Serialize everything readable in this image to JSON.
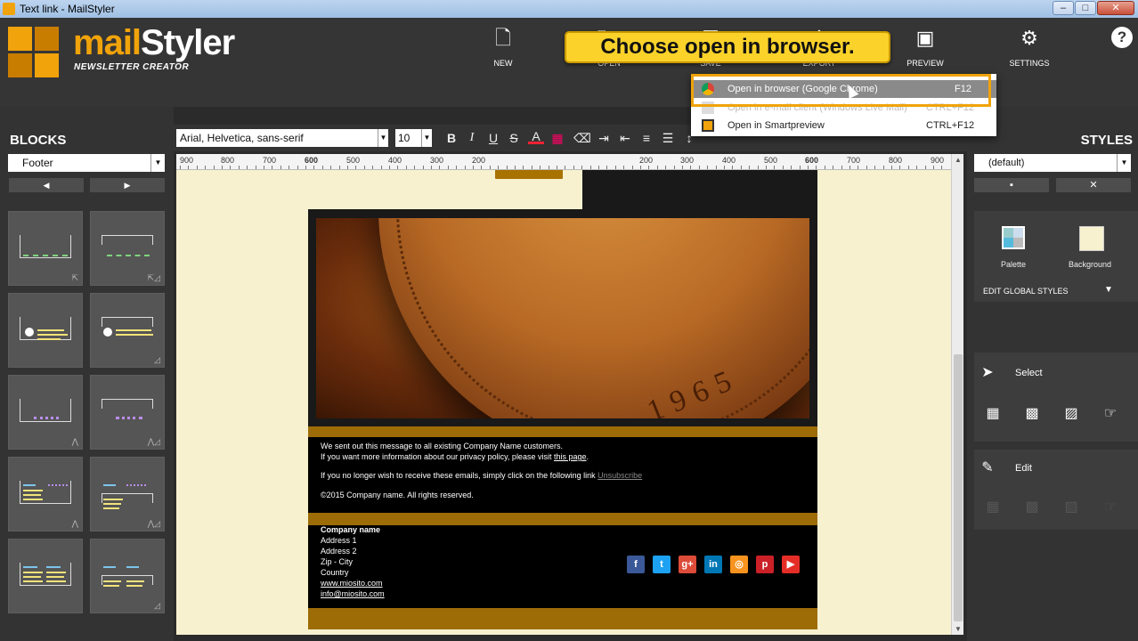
{
  "window": {
    "title": "Text link - MailStyler",
    "minimize": "–",
    "maximize": "□",
    "close": "✕"
  },
  "logo": {
    "brand_a": "mail",
    "brand_b": "Styler",
    "subtitle": "NEWSLETTER CREATOR"
  },
  "toolbar": {
    "new": "NEW",
    "open": "OPEN",
    "save": "SAVE",
    "export": "EXPORT",
    "preview": "PREVIEW",
    "settings": "SETTINGS",
    "help": "?"
  },
  "callout": "Choose open in browser.",
  "export_menu": {
    "items": [
      {
        "label": "Open in browser (Google Chrome)",
        "shortcut": "F12",
        "icon": "chrome-icon"
      },
      {
        "label": "Open in e-mail client (Windows Live Mail)",
        "shortcut": "CTRL+F12",
        "icon": "mail-icon"
      },
      {
        "label": "Open in Smartpreview",
        "shortcut": "CTRL+F12",
        "icon": "smartpreview-icon"
      }
    ]
  },
  "blocks": {
    "title": "BLOCKS",
    "category": "Footer",
    "prev": "◀",
    "next": "▶"
  },
  "format": {
    "font": "Arial, Helvetica, sans-serif",
    "size": "10"
  },
  "ruler": {
    "labels_left": [
      "900",
      "800",
      "700",
      "600",
      "500",
      "400",
      "300",
      "200"
    ],
    "labels_right": [
      "200",
      "300",
      "400",
      "500",
      "600",
      "700",
      "800",
      "900"
    ]
  },
  "email": {
    "footer_line1": "We sent out this message to all existing Company Name customers.",
    "footer_line2_a": "If you want more information about our privacy policy, please visit ",
    "footer_line2_link": "this page",
    "footer_line3_a": "If you no longer wish to receive these emails, simply click on the following link ",
    "footer_line3_link": "Unsubscribe",
    "copyright": "©2015 Company name. All rights reserved.",
    "company": "Company name",
    "address1": "Address 1",
    "address2": "Address 2",
    "zip_city": "Zip - City",
    "country": "Country",
    "website": "www.miosito.com",
    "email": "info@miosito.com",
    "coin_year": "1965",
    "social": [
      {
        "icon": "facebook-icon",
        "glyph": "f",
        "color": "#3b5998"
      },
      {
        "icon": "twitter-icon",
        "glyph": "t",
        "color": "#1da1f2"
      },
      {
        "icon": "googleplus-icon",
        "glyph": "g+",
        "color": "#dd4b39"
      },
      {
        "icon": "linkedin-icon",
        "glyph": "in",
        "color": "#0077b5"
      },
      {
        "icon": "rss-icon",
        "glyph": "◎",
        "color": "#f7931e"
      },
      {
        "icon": "pinterest-icon",
        "glyph": "p",
        "color": "#cb2027"
      },
      {
        "icon": "youtube-icon",
        "glyph": "▶",
        "color": "#e52d27"
      }
    ]
  },
  "styles": {
    "title": "STYLES",
    "selected": "(default)",
    "save": "💾",
    "delete": "✕",
    "palette": "Palette",
    "background": "Background",
    "edit_global": "EDIT GLOBAL STYLES",
    "select": "Select",
    "edit": "Edit"
  }
}
